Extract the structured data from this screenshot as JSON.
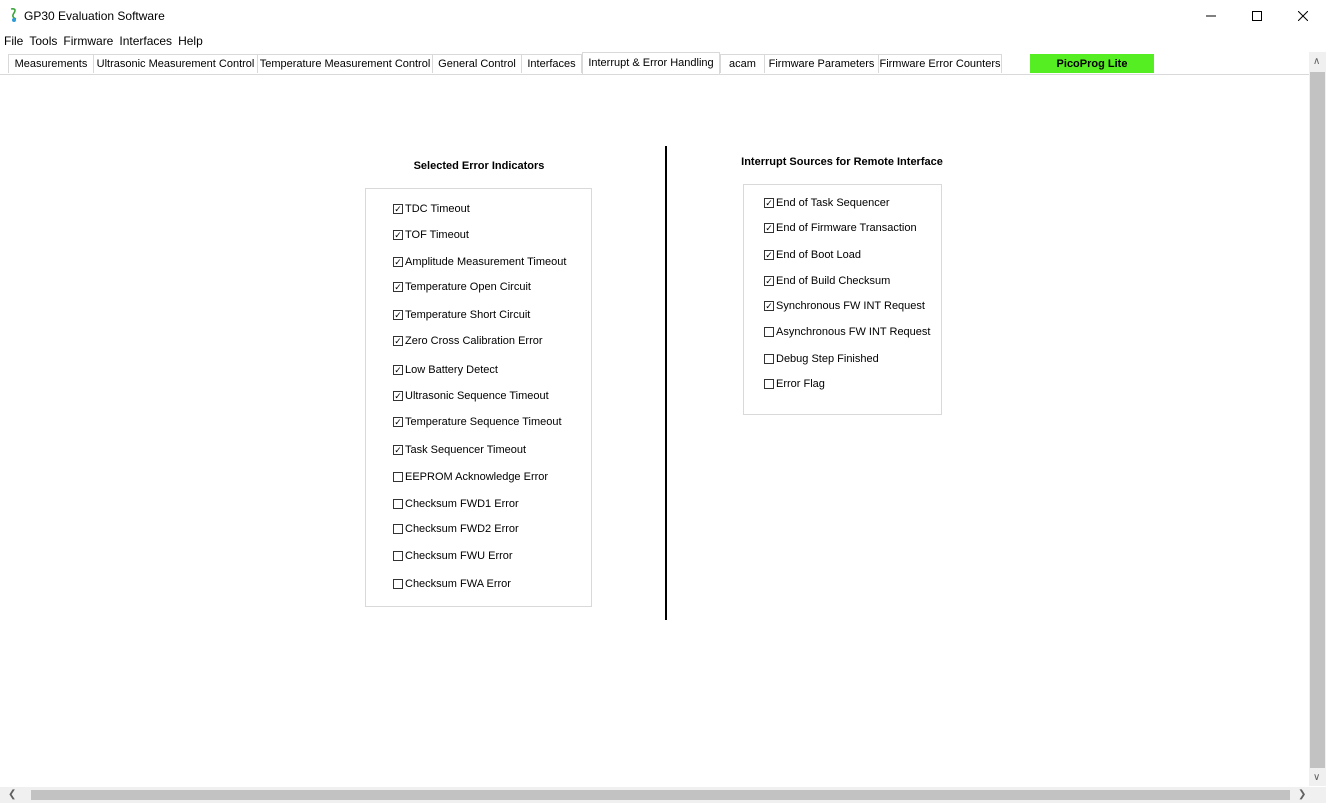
{
  "window": {
    "title": "GP30 Evaluation Software"
  },
  "menu": [
    "File",
    "Tools",
    "Firmware",
    "Interfaces",
    "Help"
  ],
  "tabs": [
    {
      "label": "Measurements"
    },
    {
      "label": "Ultrasonic Measurement Control"
    },
    {
      "label": "Temperature Measurement Control"
    },
    {
      "label": "General Control"
    },
    {
      "label": "Interfaces"
    },
    {
      "label": "Interrupt & Error Handling"
    },
    {
      "label": "acam"
    },
    {
      "label": "Firmware Parameters"
    },
    {
      "label": "Firmware Error Counters"
    },
    {
      "label": "PicoProg Lite"
    }
  ],
  "active_tab": "Interrupt & Error Handling",
  "colors": {
    "picoprog_tab": "#55ee22"
  },
  "error_panel": {
    "heading": "Selected Error Indicators",
    "items": [
      {
        "label": "TDC Timeout",
        "checked": true
      },
      {
        "label": "TOF Timeout",
        "checked": true
      },
      {
        "label": "Amplitude Measurement Timeout",
        "checked": true
      },
      {
        "label": "Temperature Open Circuit",
        "checked": true
      },
      {
        "label": "Temperature Short Circuit",
        "checked": true
      },
      {
        "label": "Zero Cross Calibration Error",
        "checked": true
      },
      {
        "label": "Low Battery Detect",
        "checked": true
      },
      {
        "label": "Ultrasonic Sequence Timeout",
        "checked": true
      },
      {
        "label": "Temperature Sequence Timeout",
        "checked": true
      },
      {
        "label": "Task Sequencer Timeout",
        "checked": true
      },
      {
        "label": "EEPROM Acknowledge Error",
        "checked": false
      },
      {
        "label": "Checksum FWD1 Error",
        "checked": false
      },
      {
        "label": "Checksum FWD2 Error",
        "checked": false
      },
      {
        "label": "Checksum FWU Error",
        "checked": false
      },
      {
        "label": "Checksum FWA Error",
        "checked": false
      }
    ]
  },
  "interrupt_panel": {
    "heading": "Interrupt Sources for Remote Interface",
    "items": [
      {
        "label": "End of Task Sequencer",
        "checked": true
      },
      {
        "label": "End of Firmware Transaction",
        "checked": true
      },
      {
        "label": "End of Boot Load",
        "checked": true
      },
      {
        "label": "End of Build Checksum",
        "checked": true
      },
      {
        "label": "Synchronous FW INT Request",
        "checked": true
      },
      {
        "label": "Asynchronous FW INT Request",
        "checked": false
      },
      {
        "label": "Debug Step Finished",
        "checked": false
      },
      {
        "label": "Error Flag",
        "checked": false
      }
    ]
  }
}
